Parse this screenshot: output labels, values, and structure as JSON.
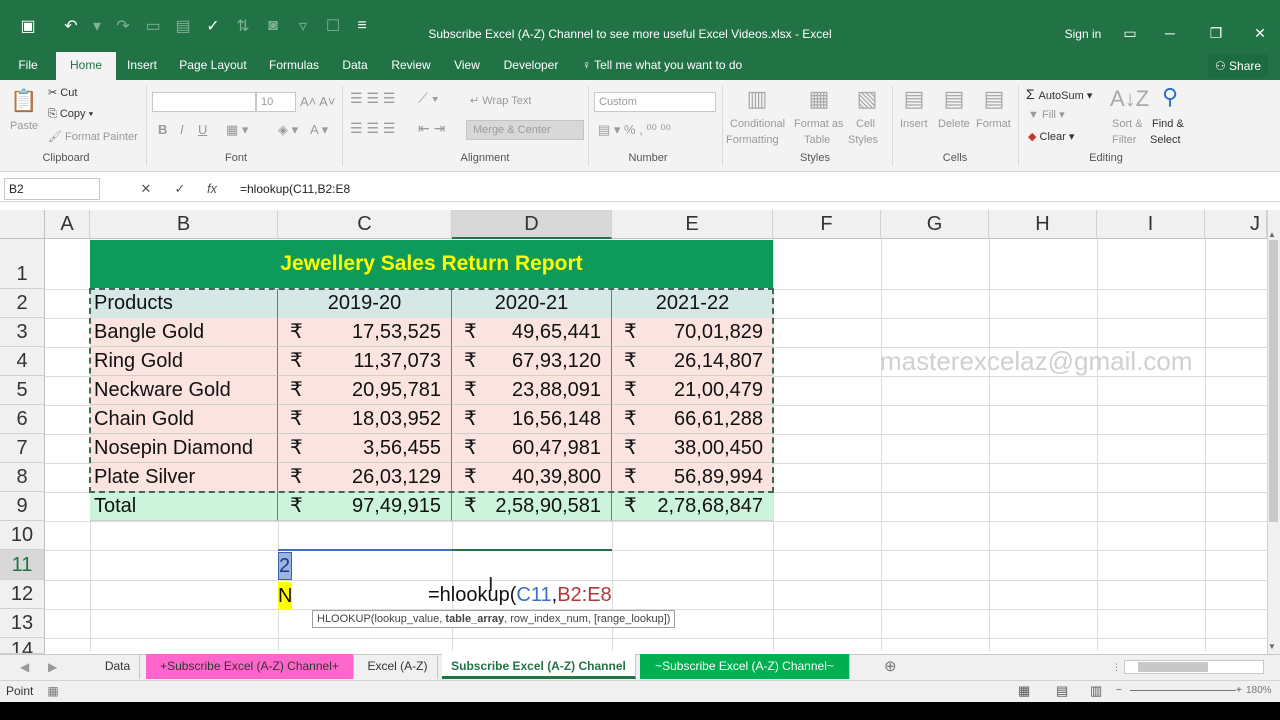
{
  "window": {
    "title": "Subscribe Excel (A-Z) Channel to see more useful Excel Videos.xlsx - Excel",
    "sign_in": "Sign in"
  },
  "menu": {
    "tabs": [
      "File",
      "Home",
      "Insert",
      "Page Layout",
      "Formulas",
      "Data",
      "Review",
      "View",
      "Developer"
    ],
    "active_tab": "Home",
    "tell_me": "Tell me what you want to do",
    "share": "Share"
  },
  "ribbon": {
    "clipboard": {
      "paste": "Paste",
      "cut": "Cut",
      "copy": "Copy",
      "format_painter": "Format Painter",
      "label": "Clipboard"
    },
    "font": {
      "size": "10",
      "label": "Font",
      "bold": "B",
      "italic": "I",
      "underline": "U"
    },
    "alignment": {
      "wrap_text": "Wrap Text",
      "merge_center": "Merge & Center",
      "label": "Alignment"
    },
    "number": {
      "format": "Custom",
      "label": "Number"
    },
    "styles": {
      "conditional": "Conditional",
      "conditional2": "Formatting",
      "format_as": "Format as",
      "format_as2": "Table",
      "cell": "Cell",
      "cell2": "Styles",
      "label": "Styles"
    },
    "cells": {
      "insert": "Insert",
      "delete": "Delete",
      "format": "Format",
      "label": "Cells"
    },
    "editing": {
      "autosum": "AutoSum",
      "fill": "Fill",
      "clear": "Clear",
      "sort": "Sort &",
      "sort2": "Filter",
      "find": "Find &",
      "find2": "Select",
      "label": "Editing"
    }
  },
  "formula_bar": {
    "name_box": "B2",
    "formula": "=hlookup(C11,B2:E8",
    "cancel": "✕",
    "enter": "✓",
    "fx": "fx"
  },
  "columns": [
    "A",
    "B",
    "C",
    "D",
    "E",
    "F",
    "G",
    "H",
    "I",
    "J"
  ],
  "rows": [
    "1",
    "2",
    "3",
    "4",
    "5",
    "6",
    "7",
    "8",
    "9",
    "10",
    "11",
    "12",
    "13",
    "14"
  ],
  "report": {
    "title": "Jewellery Sales Return Report",
    "headers": [
      "Products",
      "2019-20",
      "2020-21",
      "2021-22"
    ],
    "currency": "₹",
    "rows": [
      {
        "product": "Bangle Gold",
        "values": [
          "17,53,525",
          "49,65,441",
          "70,01,829"
        ]
      },
      {
        "product": "Ring Gold",
        "values": [
          "11,37,073",
          "67,93,120",
          "26,14,807"
        ]
      },
      {
        "product": "Neckware Gold",
        "values": [
          "20,95,781",
          "23,88,091",
          "21,00,479"
        ]
      },
      {
        "product": "Chain Gold",
        "values": [
          "18,03,952",
          "16,56,148",
          "66,61,288"
        ]
      },
      {
        "product": "Nosepin Diamond",
        "values": [
          "3,56,455",
          "60,47,981",
          "38,00,450"
        ]
      },
      {
        "product": "Plate Silver",
        "values": [
          "26,03,129",
          "40,39,800",
          "56,89,994"
        ]
      }
    ],
    "total": {
      "label": "Total",
      "values": [
        "97,49,915",
        "2,58,90,581",
        "2,78,68,847"
      ]
    }
  },
  "watermark": "masterexcelaz@gmail.com",
  "cell_c11": "2",
  "cell_c12": "N",
  "editing_cell": {
    "prefix": "=hlookup(",
    "ref1": "C11",
    "comma": ",",
    "ref2": "B2:E8"
  },
  "tooltip": {
    "fn": "HLOOKUP(lookup_value, ",
    "bold": "table_array",
    "rest": ", row_index_num, [range_lookup])"
  },
  "sheets": [
    {
      "name": "Data",
      "style": "plain"
    },
    {
      "name": "+Subscribe Excel (A-Z) Channel+",
      "style": "pink"
    },
    {
      "name": "Excel (A-Z)",
      "style": "plain"
    },
    {
      "name": "Subscribe Excel (A-Z) Channel",
      "style": "active"
    },
    {
      "name": "~Subscribe Excel (A-Z) Channel~",
      "style": "green"
    }
  ],
  "status": {
    "mode": "Point",
    "zoom": "180%"
  },
  "colors": {
    "excel_green": "#217346",
    "title_fill": "#0e9a5a",
    "title_text": "#ffff00",
    "pink_tab": "#ff66cc",
    "green_tab": "#00b050"
  }
}
